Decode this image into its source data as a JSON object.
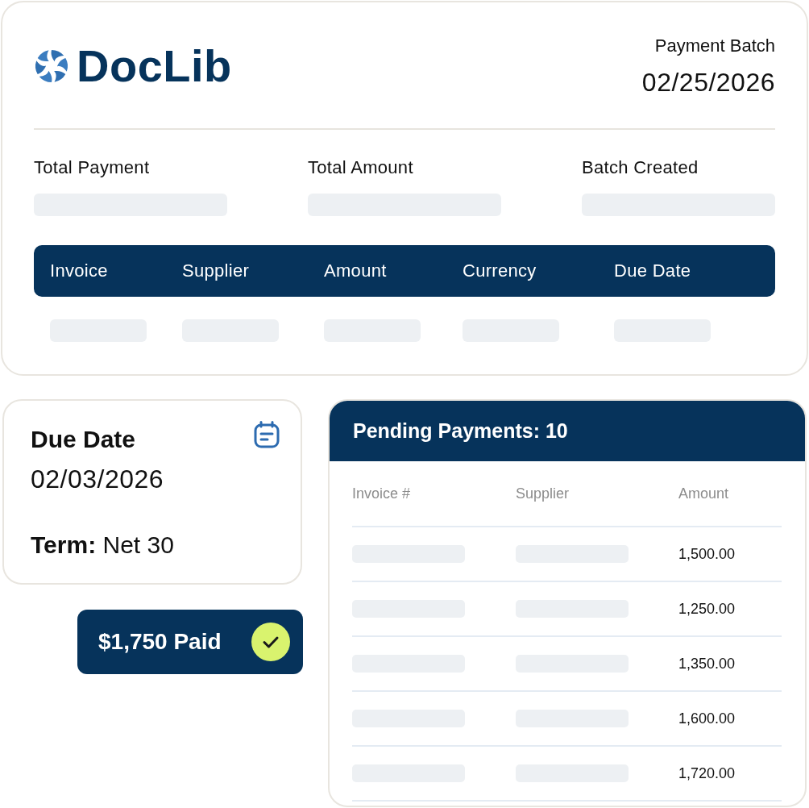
{
  "logo": {
    "text": "DocLib"
  },
  "batch": {
    "label": "Payment Batch",
    "date": "02/25/2026"
  },
  "summary_fields": [
    {
      "label": "Total Payment"
    },
    {
      "label": "Total Amount"
    },
    {
      "label": "Batch Created"
    }
  ],
  "invoice_table": {
    "columns": [
      "Invoice",
      "Supplier",
      "Amount",
      "Currency",
      "Due Date"
    ]
  },
  "due_date_card": {
    "title": "Due Date",
    "date": "02/03/2026",
    "term": "**Term:** Net 30"
  },
  "paid_badge": {
    "text": "$1,750 Paid"
  },
  "pending_payments": {
    "title": "Pending Payments: 10",
    "columns": [
      "Invoice #",
      "Supplier",
      "Amount"
    ],
    "rows": [
      {
        "amount": "1,500.00"
      },
      {
        "amount": "1,250.00"
      },
      {
        "amount": "1,350.00"
      },
      {
        "amount": "1,600.00"
      },
      {
        "amount": "1,720.00"
      }
    ]
  }
}
